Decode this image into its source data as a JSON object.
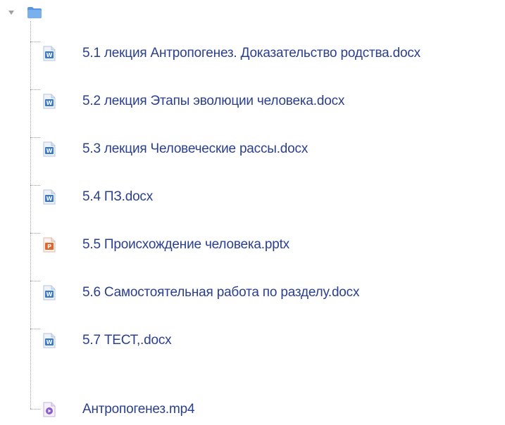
{
  "tree": {
    "root": {
      "expanded": true,
      "toggle_icon": "triangle-down-icon",
      "folder_icon": "folder-icon"
    },
    "items": [
      {
        "label": "5.1 лекция Антропогенез. Доказательство родства.docx",
        "icon": "word-document-icon"
      },
      {
        "label": "5.2 лекция Этапы эволюции человека.docx",
        "icon": "word-document-icon"
      },
      {
        "label": "5.3 лекция Человеческие рассы.docx",
        "icon": "word-document-icon"
      },
      {
        "label": "5.4 ПЗ.docx",
        "icon": "word-document-icon"
      },
      {
        "label": "5.5 Происхождение человека.pptx",
        "icon": "powerpoint-document-icon"
      },
      {
        "label": "5.6 Самостоятельная работа по разделу.docx",
        "icon": "word-document-icon"
      },
      {
        "label": "5.7 ТЕСТ,.docx",
        "icon": "word-document-icon"
      },
      {
        "label": "Антропогенез.mp4",
        "icon": "video-file-icon"
      }
    ]
  },
  "colors": {
    "link_text": "#2a3f8f",
    "folder": "#5a96dc",
    "word_icon": "#3c78c8",
    "powerpoint_icon": "#e0662e",
    "video_icon": "#8a5cc8",
    "tree_lines": "#9a9a9a"
  }
}
